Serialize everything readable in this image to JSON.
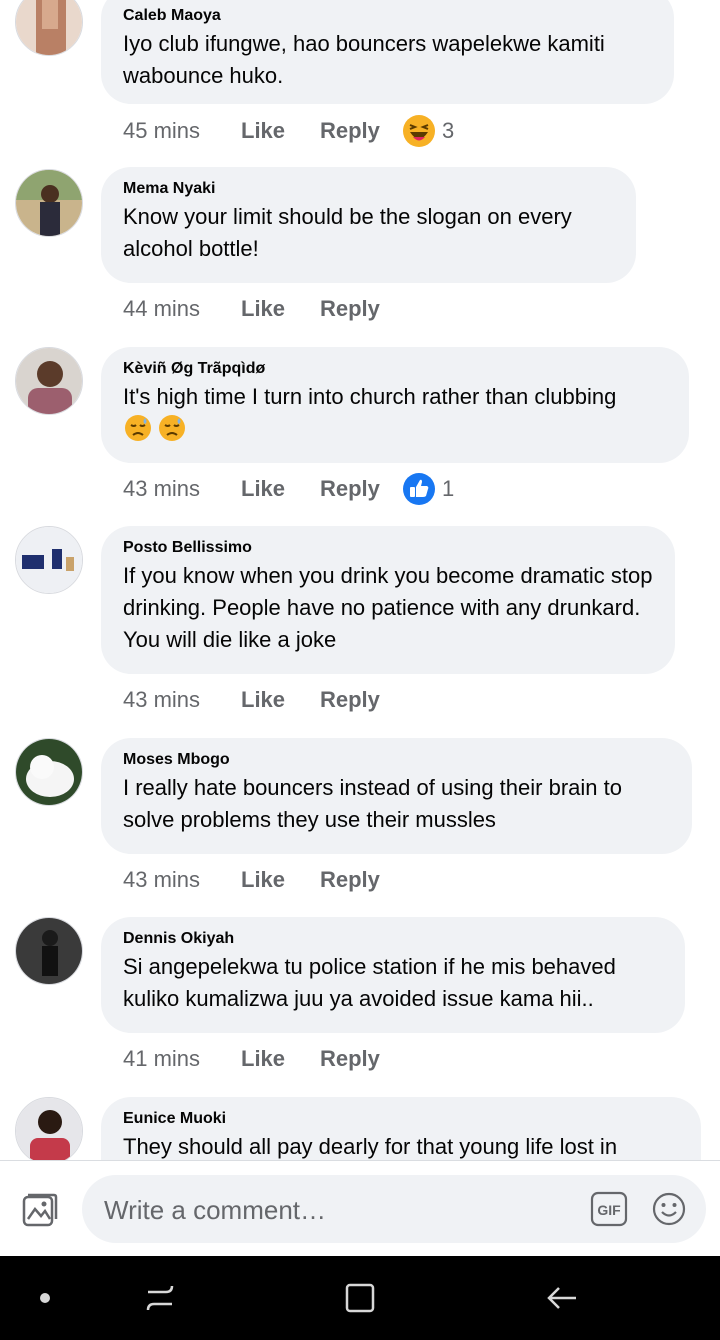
{
  "comments": [
    {
      "author": "Caleb Maoya",
      "text": "Iyo club ifungwe, hao bouncers wapelekwe kamiti wabounce huko.",
      "time": "45 mins",
      "like": "Like",
      "reply": "Reply",
      "reaction": "haha",
      "reaction_count": "3"
    },
    {
      "author": "Mema Nyaki",
      "text": "Know your limit should be the slogan on every alcohol bottle!",
      "time": "44 mins",
      "like": "Like",
      "reply": "Reply"
    },
    {
      "author": "Kèviñ Øg Trãpqìdø",
      "text": "It's high time I turn into church rather than clubbing",
      "emojis": "😓😓",
      "time": "43 mins",
      "like": "Like",
      "reply": "Reply",
      "reaction": "like",
      "reaction_count": "1"
    },
    {
      "author": "Posto Bellissimo",
      "text": "If you know when you drink you become dramatic stop drinking. People have no patience with any drunkard. You will die like a joke",
      "time": "43 mins",
      "like": "Like",
      "reply": "Reply"
    },
    {
      "author": "Moses Mbogo",
      "text": "I really hate bouncers instead of using their brain to solve problems they use their mussles",
      "time": "43 mins",
      "like": "Like",
      "reply": "Reply"
    },
    {
      "author": "Dennis Okiyah",
      "text": "Si angepelekwa tu police station if he mis behaved kuliko kumalizwa juu ya avoided issue kama hii..",
      "time": "41 mins",
      "like": "Like",
      "reply": "Reply"
    },
    {
      "author": "Eunice Muoki",
      "text": "They should all pay dearly for that young life lost in"
    }
  ],
  "composer": {
    "placeholder": "Write a comment…",
    "gif_label": "GIF"
  },
  "colors": {
    "bubble": "#f0f2f5",
    "secondary_text": "#65676b",
    "like_blue": "#1877f2",
    "haha_yellow": "#f7b125"
  },
  "icons": [
    "photo-icon",
    "gif-icon",
    "emoji-icon",
    "nav-dot-icon",
    "recent-apps-icon",
    "home-icon",
    "back-icon"
  ]
}
